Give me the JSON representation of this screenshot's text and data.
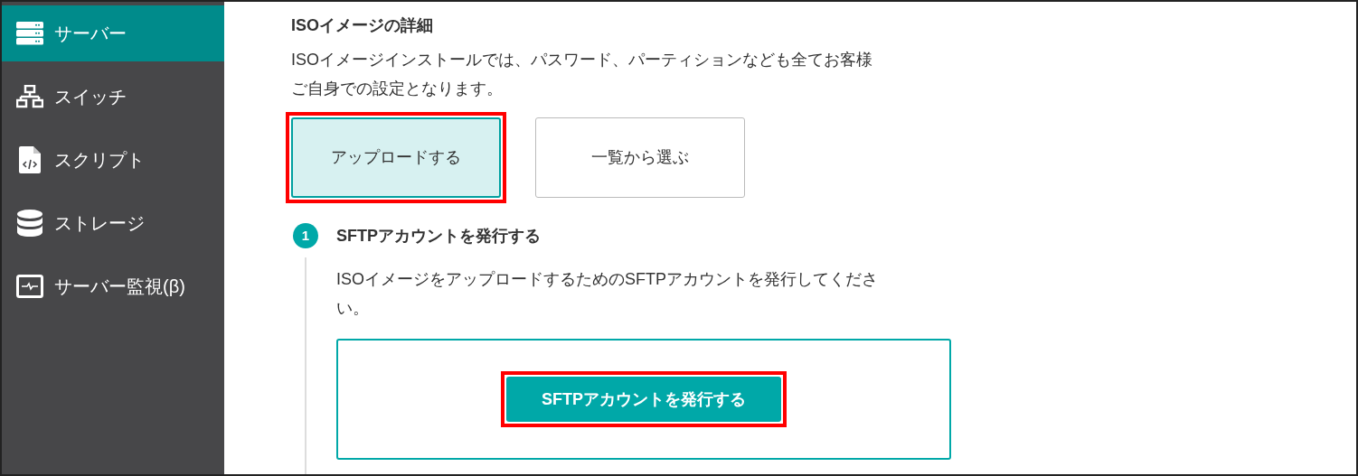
{
  "sidebar": {
    "items": [
      {
        "label": "サーバー",
        "kind": "server",
        "selected": true
      },
      {
        "label": "スイッチ",
        "kind": "network",
        "selected": false
      },
      {
        "label": "スクリプト",
        "kind": "script",
        "selected": false
      },
      {
        "label": "ストレージ",
        "kind": "storage",
        "selected": false
      },
      {
        "label": "サーバー監視(β)",
        "kind": "monitor",
        "selected": false
      }
    ]
  },
  "section": {
    "title": "ISOイメージの詳細",
    "description": "ISOイメージインストールでは、パスワード、パーティションなども全てお客様ご自身での設定となります。",
    "options": [
      {
        "label": "アップロードする",
        "selected": true,
        "highlighted": true
      },
      {
        "label": "一覧から選ぶ",
        "selected": false,
        "highlighted": false
      }
    ]
  },
  "steps": [
    {
      "number": "1",
      "title": "SFTPアカウントを発行する",
      "description": "ISOイメージをアップロードするためのSFTPアカウントを発行してください。",
      "button": {
        "label": "SFTPアカウントを発行する",
        "highlighted": true
      }
    }
  ]
}
